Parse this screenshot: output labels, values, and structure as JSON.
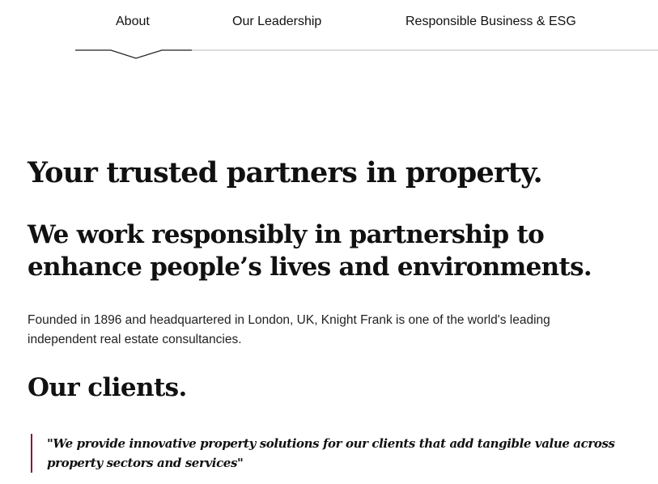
{
  "nav": {
    "tabs": [
      {
        "label": "About",
        "active": true
      },
      {
        "label": "Our Leadership",
        "active": false
      },
      {
        "label": "Responsible Business & ESG",
        "active": false
      }
    ]
  },
  "main": {
    "headline": "Your trusted partners in property.",
    "subheadline": "We work responsibly in partnership to enhance people’s lives and environments.",
    "intro": "Founded in 1896 and headquartered in London, UK, Knight Frank is one of the world's leading independent real estate consultancies.",
    "clients_heading": "Our clients.",
    "quote": "\"We provide innovative property solutions for our clients that add tangible value across property sectors and services\""
  },
  "colors": {
    "accent": "#8a1538",
    "text": "#111111",
    "divider": "#d0d0d0"
  }
}
